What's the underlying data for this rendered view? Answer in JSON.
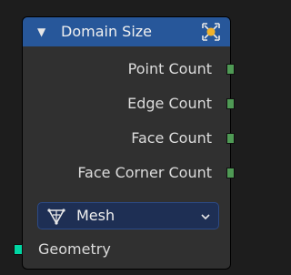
{
  "node": {
    "title": "Domain Size",
    "header_color": "#27579a",
    "outputs": [
      {
        "label": "Point Count"
      },
      {
        "label": "Edge Count"
      },
      {
        "label": "Face Count"
      },
      {
        "label": "Face Corner Count"
      }
    ],
    "component_dropdown": {
      "selected": "Mesh",
      "icon": "mesh-icon"
    },
    "inputs": [
      {
        "label": "Geometry"
      }
    ],
    "colors": {
      "integer_socket": "#4f9a55",
      "geometry_socket": "#00d6a3",
      "node_body": "#303030"
    }
  }
}
